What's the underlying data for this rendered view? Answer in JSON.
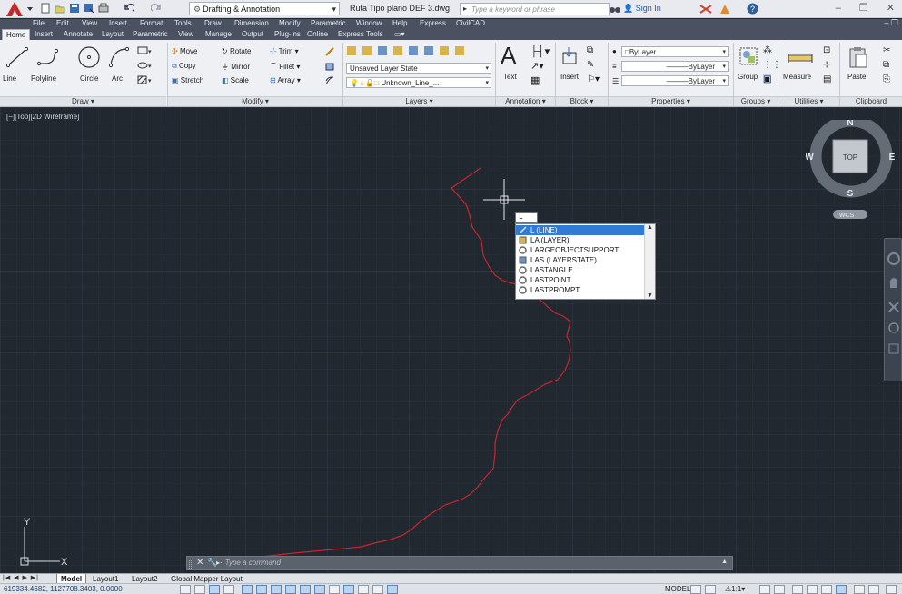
{
  "titlebar": {
    "workspace": "Drafting & Annotation",
    "document_title": "Ruta Tipo plano DEF 3.dwg",
    "search_placeholder": "Type a keyword or phrase",
    "signin": "Sign In",
    "app_icon": "autocad-logo-icon"
  },
  "menubar": {
    "items": [
      "File",
      "Edit",
      "View",
      "Insert",
      "Format",
      "Tools",
      "Draw",
      "Dimension",
      "Modify",
      "Parametric",
      "Window",
      "Help",
      "Express",
      "CivilCAD"
    ]
  },
  "ribbon_tabs": [
    "Home",
    "Insert",
    "Annotate",
    "Layout",
    "Parametric",
    "View",
    "Manage",
    "Output",
    "Plug-ins",
    "Online",
    "Express Tools"
  ],
  "active_tab": "Home",
  "ribbon": {
    "draw": {
      "title": "Draw",
      "line": "Line",
      "polyline": "Polyline",
      "circle": "Circle",
      "arc": "Arc"
    },
    "modify": {
      "title": "Modify",
      "move": "Move",
      "rotate": "Rotate",
      "trim": "Trim",
      "copy": "Copy",
      "mirror": "Mirror",
      "fillet": "Fillet",
      "stretch": "Stretch",
      "scale": "Scale",
      "array": "Array"
    },
    "layers": {
      "title": "Layers",
      "layer_state": "Unsaved Layer State",
      "current_layer": "Unknown_Line_..."
    },
    "annotation": {
      "title": "Annotation",
      "text": "Text"
    },
    "block": {
      "title": "Block",
      "insert": "Insert"
    },
    "properties": {
      "title": "Properties",
      "color": "ByLayer",
      "linetype": "ByLayer",
      "lineweight": "ByLayer"
    },
    "groups": {
      "title": "Groups",
      "group": "Group"
    },
    "utilities": {
      "title": "Utilities",
      "measure": "Measure"
    },
    "clipboard": {
      "title": "Clipboard",
      "paste": "Paste"
    }
  },
  "canvas": {
    "viewport_label": "[−][Top][2D Wireframe]",
    "viewcube": {
      "north": "N",
      "south": "S",
      "east": "E",
      "west": "W",
      "face": "TOP",
      "ucs_menu": "WCS"
    },
    "ucs": {
      "x": "X",
      "y": "Y"
    }
  },
  "autocomplete": {
    "typed": "L",
    "items": [
      {
        "label": "L (LINE)",
        "icon": "line-icon",
        "selected": true
      },
      {
        "label": "LA (LAYER)",
        "icon": "layer-icon",
        "selected": false
      },
      {
        "label": "LARGEOBJECTSUPPORT",
        "icon": "system-variable-icon",
        "selected": false
      },
      {
        "label": "LAS (LAYERSTATE)",
        "icon": "layer-state-icon",
        "selected": false
      },
      {
        "label": "LASTANGLE",
        "icon": "system-variable-icon",
        "selected": false
      },
      {
        "label": "LASTPOINT",
        "icon": "system-variable-icon",
        "selected": false
      },
      {
        "label": "LASTPROMPT",
        "icon": "system-variable-icon",
        "selected": false
      }
    ]
  },
  "command_line": {
    "placeholder": "Type a command",
    "prompt_prefix": "▸·"
  },
  "layout_tabs": [
    "Model",
    "Layout1",
    "Layout2",
    "Global Mapper Layout"
  ],
  "active_layout": "Model",
  "statusbar": {
    "coordinates": "619334.4682, 1127708.3403, 0.0000",
    "space": "MODEL",
    "annotation_scale": "1:1"
  },
  "colors": {
    "canvas_bg": "#212830",
    "grid_line": "#2c3540",
    "route_line": "#c8262c",
    "selection": "#2f7bd6",
    "ribbon_bg": "#eef0f3",
    "menubar_bg": "#4a5262"
  }
}
